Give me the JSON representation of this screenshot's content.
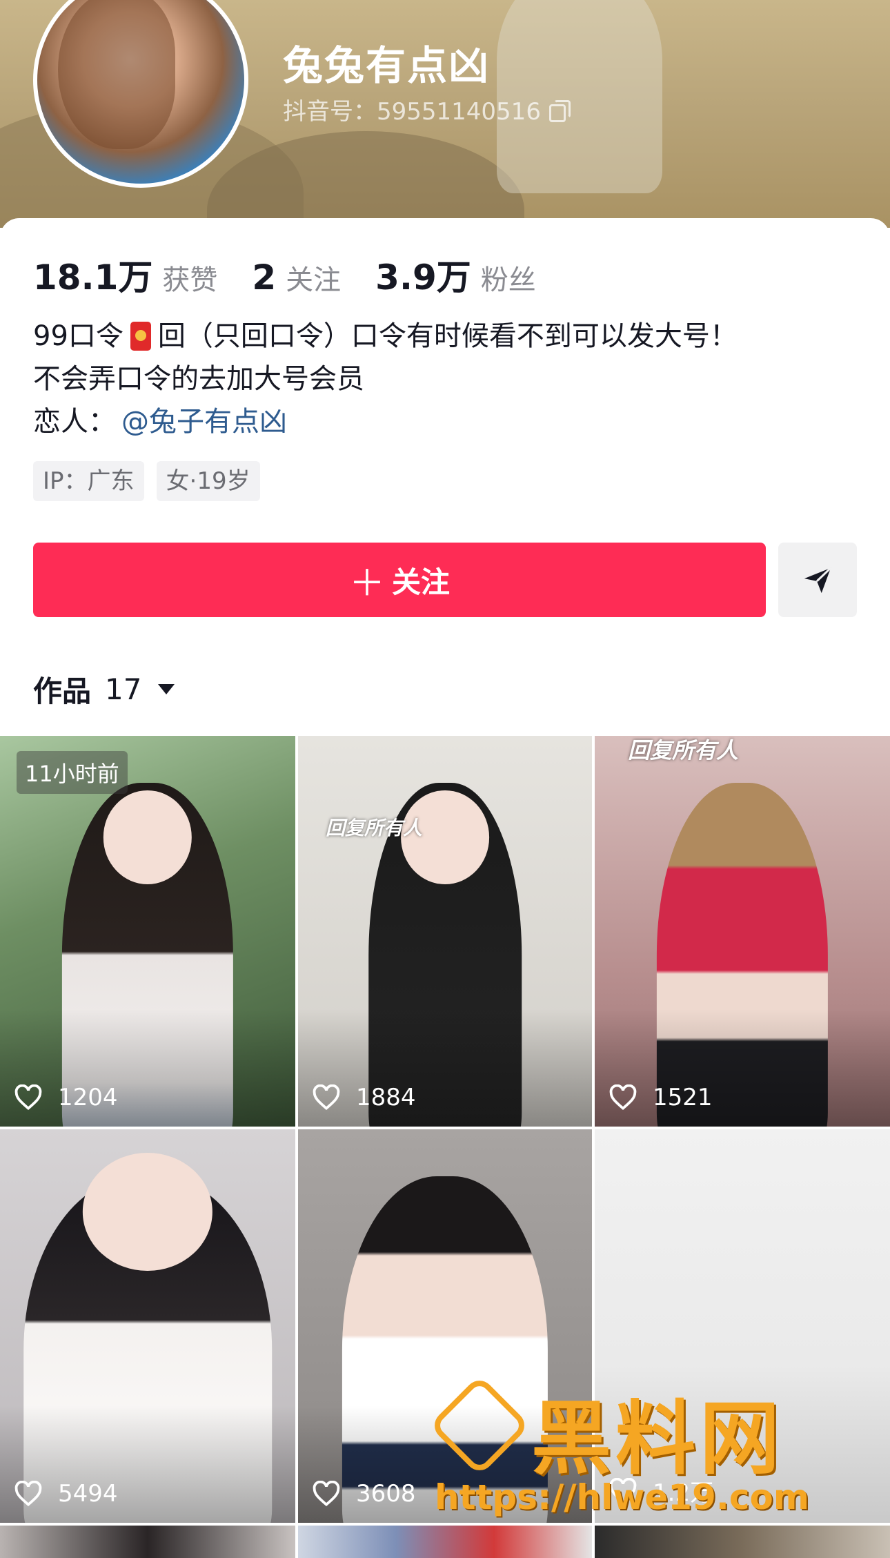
{
  "profile": {
    "nickname": "兔兔有点凶",
    "douyin_id": "抖音号：59551140516"
  },
  "stats": [
    {
      "num": "18.1万",
      "label": "获赞"
    },
    {
      "num": "2",
      "label": "关注"
    },
    {
      "num": "3.9万",
      "label": "粉丝"
    }
  ],
  "bio": {
    "line1_a": "99口令",
    "line1_b": "回（只回口令）口令有时候看不到可以发大号！",
    "line2": "不会弄口令的去加大号会员",
    "line3_label": "恋人：",
    "line3_mention": "@兔子有点凶"
  },
  "tags": [
    "IP：广东",
    "女·19岁"
  ],
  "actions": {
    "follow_label": "关注",
    "plus": "＋"
  },
  "works": {
    "label": "作品",
    "count": "17"
  },
  "videos": [
    {
      "likes": "1204",
      "badge": "11小时前",
      "overlay": ""
    },
    {
      "likes": "1884",
      "badge": "",
      "overlay": "回复所有人"
    },
    {
      "likes": "1521",
      "badge": "",
      "overlay": "回复所有人"
    },
    {
      "likes": "5494",
      "badge": "",
      "overlay": ""
    },
    {
      "likes": "3608",
      "badge": "",
      "overlay": ""
    },
    {
      "likes": "1.2万",
      "badge": "",
      "overlay": ""
    }
  ],
  "watermark": {
    "brand": "黑料网",
    "url": "https://hlwe19.com"
  },
  "colors": {
    "accent": "#fe2c55",
    "mention": "#2e5b8f",
    "watermark": "#f5a623"
  }
}
